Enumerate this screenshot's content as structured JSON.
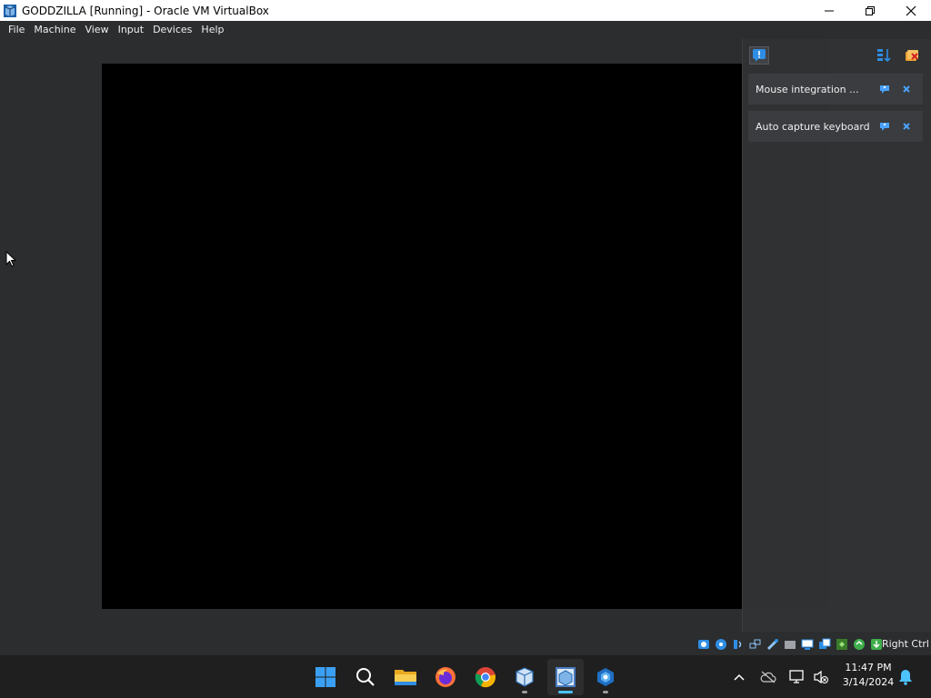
{
  "window": {
    "title": "GODDZILLA [Running] - Oracle VM VirtualBox",
    "icon": "virtualbox-icon",
    "controls": [
      "minimize-icon",
      "restore-icon",
      "close-icon"
    ]
  },
  "menubar": {
    "items": [
      {
        "label": "File"
      },
      {
        "label": "Machine"
      },
      {
        "label": "View"
      },
      {
        "label": "Input"
      },
      {
        "label": "Devices"
      },
      {
        "label": "Help"
      }
    ]
  },
  "notification_center": {
    "toolbar": {
      "left_icon": "notification-center-icon",
      "right_icons": [
        "sort-icon",
        "clear-all-icon"
      ]
    },
    "notifications": [
      {
        "text": "Mouse integration ...",
        "actions": [
          "toggle-icon",
          "close-icon"
        ]
      },
      {
        "text": "Auto capture keyboard ...",
        "actions": [
          "toggle-icon",
          "close-icon"
        ]
      }
    ]
  },
  "statusbar": {
    "icons": [
      "hard-disk-icon",
      "optical-drive-icon",
      "audio-icon",
      "network-icon",
      "usb-icon",
      "shared-folders-icon",
      "display-icon",
      "recording-icon",
      "virtualization-engine-icon",
      "mouse-integration-icon",
      "keyboard-capture-icon"
    ],
    "host_key": "Right Ctrl"
  },
  "taskbar": {
    "apps": [
      {
        "name": "start-icon"
      },
      {
        "name": "search-icon"
      },
      {
        "name": "file-explorer-icon"
      },
      {
        "name": "firefox-icon"
      },
      {
        "name": "chrome-icon"
      },
      {
        "name": "virtualbox-manager-icon"
      },
      {
        "name": "virtualbox-vm-icon"
      },
      {
        "name": "app-icon"
      }
    ],
    "tray": [
      "show-hidden-icons-chevron",
      "cloud-offline-icon",
      "network-icon",
      "volume-muted-icon",
      "notification-bell-icon"
    ],
    "time": "11:47 PM",
    "date": "3/14/2024"
  },
  "colors": {
    "accent": "#4cc2ff",
    "vm_background": "#2b2d2f",
    "vm_screen": "#000000"
  }
}
